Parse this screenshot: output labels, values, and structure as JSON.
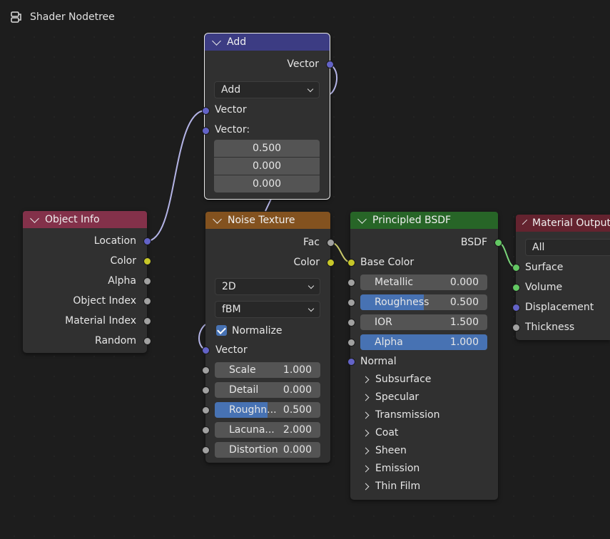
{
  "editor": {
    "title": "Shader Nodetree"
  },
  "nodes": {
    "add": {
      "title": "Add",
      "out_vector": "Vector",
      "operation": "Add",
      "in_vector": "Vector",
      "in_vector2": "Vector:",
      "v1": "0.500",
      "v2": "0.000",
      "v3": "0.000"
    },
    "object_info": {
      "title": "Object Info",
      "outputs": [
        "Location",
        "Color",
        "Alpha",
        "Object Index",
        "Material Index",
        "Random"
      ]
    },
    "noise": {
      "title": "Noise Texture",
      "out_fac": "Fac",
      "out_color": "Color",
      "dimension": "2D",
      "type": "fBM",
      "normalize": "Normalize",
      "in_vector": "Vector",
      "fields": [
        {
          "label": "Scale",
          "value": "1.000",
          "fill": 0
        },
        {
          "label": "Detail",
          "value": "0.000",
          "fill": 0
        },
        {
          "label": "Roughn...",
          "value": "0.500",
          "fill": 0.5
        },
        {
          "label": "Lacuna...",
          "value": "2.000",
          "fill": 0
        },
        {
          "label": "Distortion",
          "value": "0.000",
          "fill": 0
        }
      ]
    },
    "bsdf": {
      "title": "Principled BSDF",
      "out": "BSDF",
      "base_color": "Base Color",
      "fields": [
        {
          "label": "Metallic",
          "value": "0.000",
          "fill": 0
        },
        {
          "label": "Roughness",
          "value": "0.500",
          "fill": 0.5
        },
        {
          "label": "IOR",
          "value": "1.500",
          "fill": 0
        },
        {
          "label": "Alpha",
          "value": "1.000",
          "fill": 1
        }
      ],
      "normal": "Normal",
      "panels": [
        "Subsurface",
        "Specular",
        "Transmission",
        "Coat",
        "Sheen",
        "Emission",
        "Thin Film"
      ]
    },
    "output": {
      "title": "Material Output",
      "target": "All",
      "inputs": [
        "Surface",
        "Volume",
        "Displacement",
        "Thickness"
      ]
    }
  },
  "colors": {
    "add_header": "#3c3c83",
    "object_info_header": "#83314a",
    "noise_header": "#83521f",
    "bsdf_header": "#276527",
    "output_header": "#64232f",
    "vector_socket": "#6363c7",
    "color_socket": "#c7c729",
    "float_socket": "#a1a1a1",
    "shader_socket": "#63c763"
  }
}
